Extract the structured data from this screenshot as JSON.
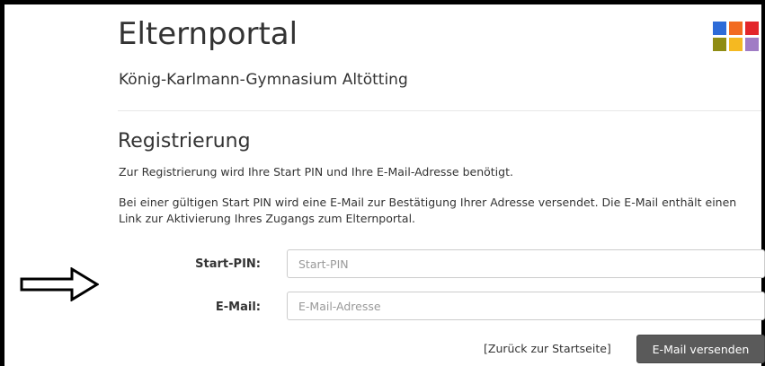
{
  "header": {
    "title": "Elternportal",
    "school": "König-Karlmann-Gymnasium Altötting",
    "logo_colors": [
      "#2d6bd8",
      "#f26b21",
      "#e3262a",
      "#8f8c14",
      "#f5b921",
      "#a07cc5"
    ]
  },
  "section": {
    "title": "Registrierung",
    "info1": "Zur Registrierung wird Ihre Start PIN und Ihre E-Mail-Adresse benötigt.",
    "info2": "Bei einer gültigen Start PIN wird eine E-Mail zur Bestätigung Ihrer Adresse versendet. Die E-Mail enthält einen Link zur Aktivierung Ihres Zugangs zum Elternportal."
  },
  "form": {
    "pin": {
      "label": "Start-PIN:",
      "placeholder": "Start-PIN",
      "value": ""
    },
    "email": {
      "label": "E-Mail:",
      "placeholder": "E-Mail-Adresse",
      "value": ""
    },
    "back_link": "[Zurück zur Startseite]",
    "submit": "E-Mail versenden"
  },
  "annotation": {
    "icon": "right-arrow-icon"
  }
}
